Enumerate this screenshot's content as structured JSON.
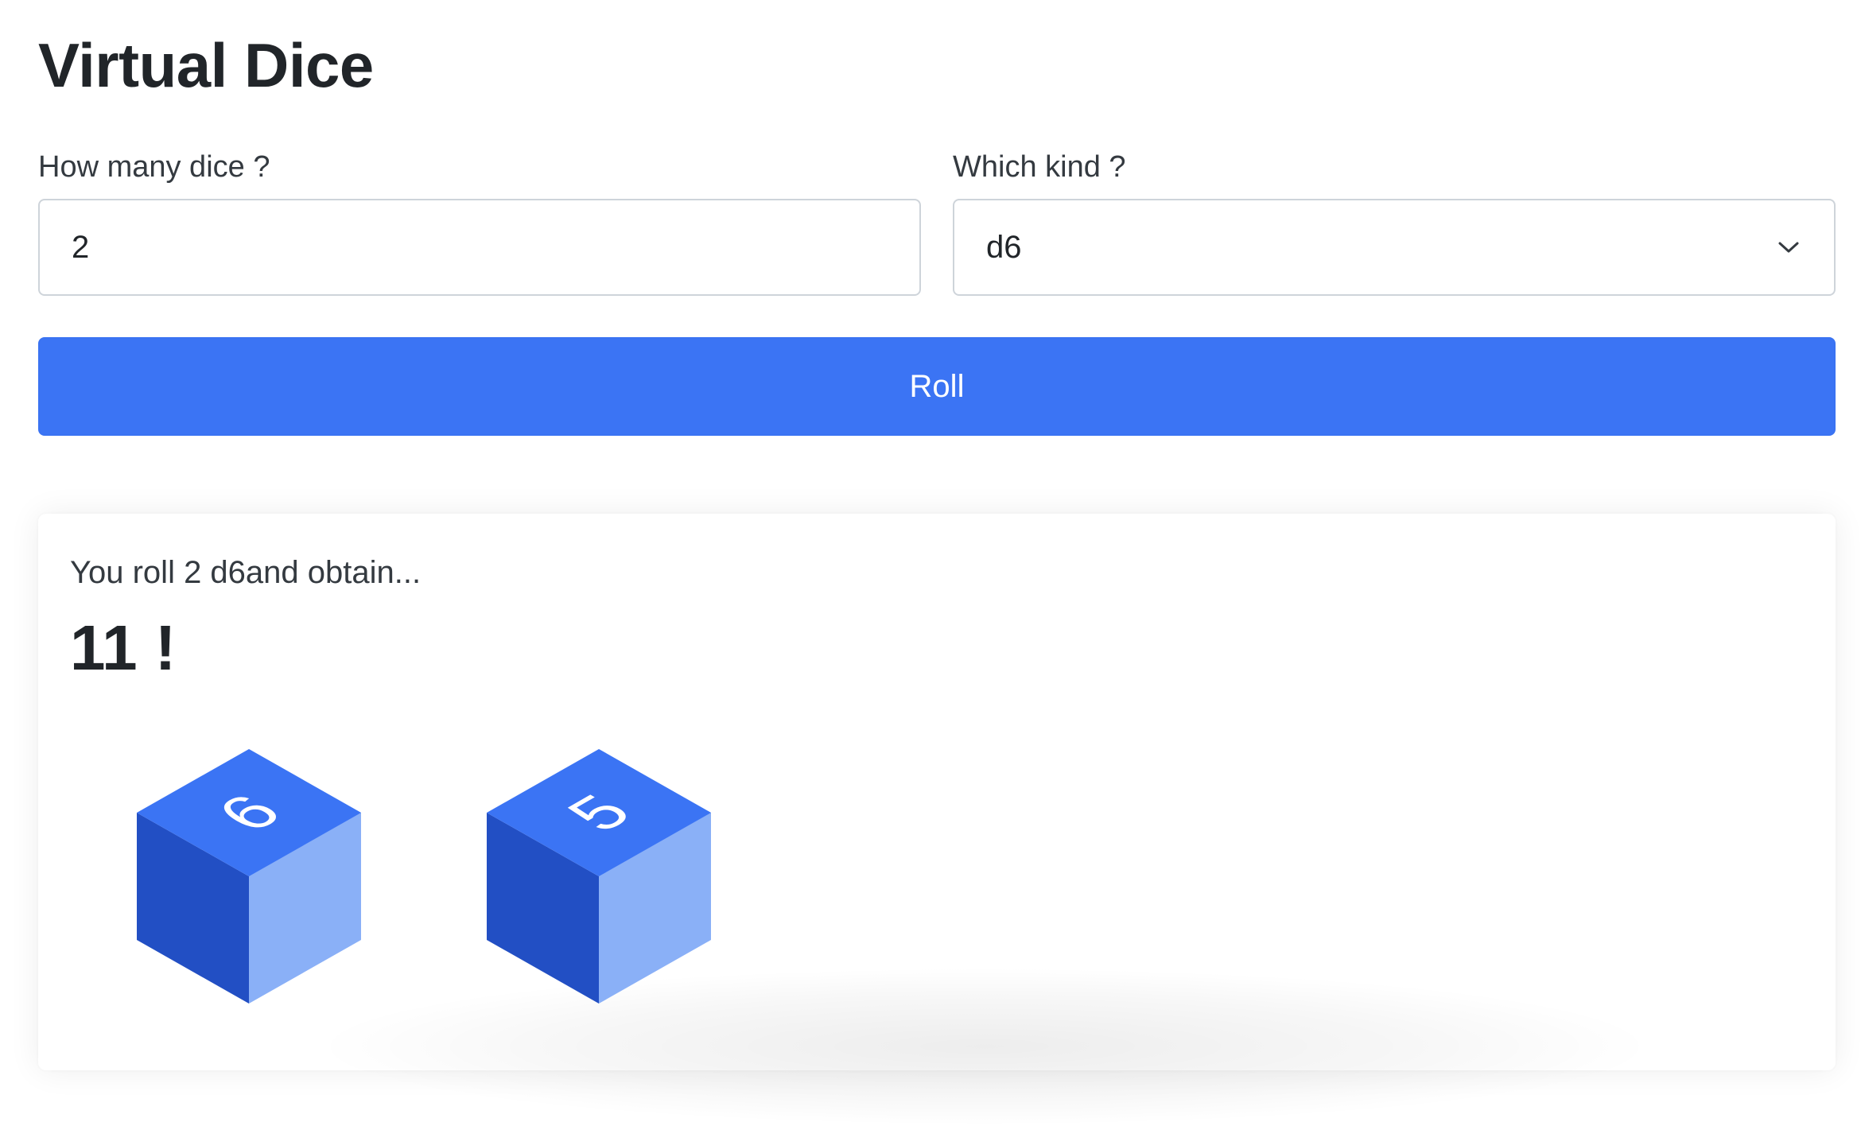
{
  "page": {
    "title": "Virtual Dice"
  },
  "form": {
    "count_label": "How many dice ?",
    "count_value": "2",
    "kind_label": "Which kind ?",
    "kind_value": "d6",
    "roll_label": "Roll"
  },
  "result": {
    "text": "You roll 2 d6and obtain...",
    "total": "11 !",
    "dice": [
      {
        "face": "6"
      },
      {
        "face": "5"
      }
    ]
  },
  "colors": {
    "accent": "#3b74f4",
    "die_top": "#3b74f4",
    "die_left": "#224fc4",
    "die_right": "#8ab0f7"
  },
  "icons": {
    "select_arrow": "chevron-down-icon"
  }
}
